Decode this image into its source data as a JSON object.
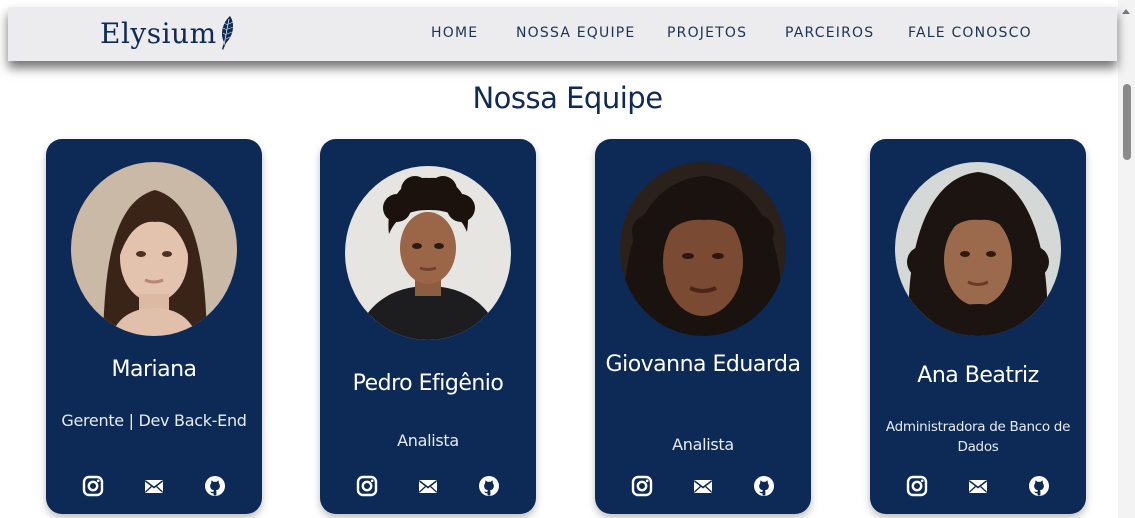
{
  "brand": {
    "name": "Elysium",
    "icon": "feather-icon"
  },
  "nav": {
    "items": [
      {
        "label": "HOME"
      },
      {
        "label": "NOSSA EQUIPE"
      },
      {
        "label": "PROJETOS"
      },
      {
        "label": "PARCEIROS"
      },
      {
        "label": "FALE CONOSCO"
      }
    ]
  },
  "page": {
    "title": "Nossa Equipe"
  },
  "team": [
    {
      "name": "Mariana",
      "role": "Gerente | Dev Back-End"
    },
    {
      "name": "Pedro Efigênio",
      "role": "Analista"
    },
    {
      "name": "Giovanna Eduarda",
      "role": "Analista"
    },
    {
      "name": "Ana Beatriz",
      "role": "Administradora de Banco de Dados"
    }
  ],
  "social_icons": [
    "instagram-icon",
    "mail-icon",
    "github-icon"
  ],
  "colors": {
    "card": "#0c2a55",
    "accent": "#0e2a55",
    "nav_bg": "#ececef",
    "text_light": "#ffffff"
  }
}
